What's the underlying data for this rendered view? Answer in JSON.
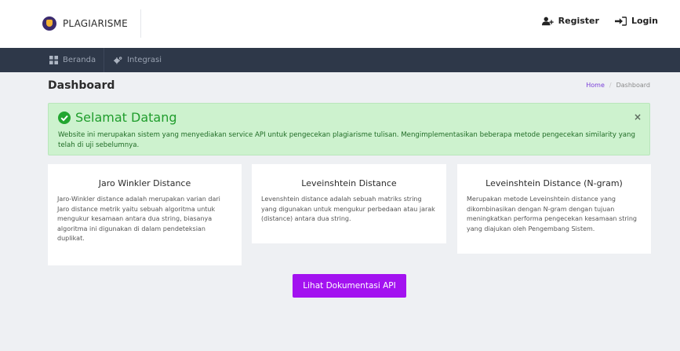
{
  "brand": {
    "name": "PLAGIARISME"
  },
  "topnav": {
    "register": "Register",
    "login": "Login"
  },
  "mainnav": [
    {
      "label": "Beranda",
      "icon": "grid-icon"
    },
    {
      "label": "Integrasi",
      "icon": "gears-icon"
    }
  ],
  "header": {
    "title": "Dashboard"
  },
  "breadcrumb": {
    "home": "Home",
    "separator": "/",
    "current": "Dashboard"
  },
  "alert": {
    "title": "Selamat Datang",
    "text": "Website ini merupakan sistem yang menyediakan service API untuk pengecekan plagiarisme tulisan. Mengimplementasikan beberapa metode pengecekan similarity yang telah di uji sebelumnya.",
    "close": "×"
  },
  "cards": [
    {
      "title": "Jaro Winkler Distance",
      "body": "Jaro-Winkler distance adalah merupakan varian dari Jaro distance metrik yaitu sebuah algoritma untuk mengukur kesamaan antara dua string, biasanya algoritma ini digunakan di dalam pendeteksian duplikat."
    },
    {
      "title": "Leveinshtein Distance",
      "body": "Levenshtein distance adalah sebuah matriks string yang digunakan untuk mengukur perbedaan atau jarak (distance) antara dua string."
    },
    {
      "title": "Leveinshtein Distance (N-gram)",
      "body": "Merupakan metode Leveinshtein distance yang dikombinasikan dengan N-gram dengan tujuan meningkatkan performa pengecekan kesamaan string yang diajukan oleh Pengembang Sistem."
    }
  ],
  "cta": {
    "label": "Lihat Dokumentasi API"
  },
  "colors": {
    "accent": "#a312f0",
    "navbar": "#2e3849",
    "success_bg": "#cdf2ce",
    "success_text": "#1f9d2c"
  }
}
